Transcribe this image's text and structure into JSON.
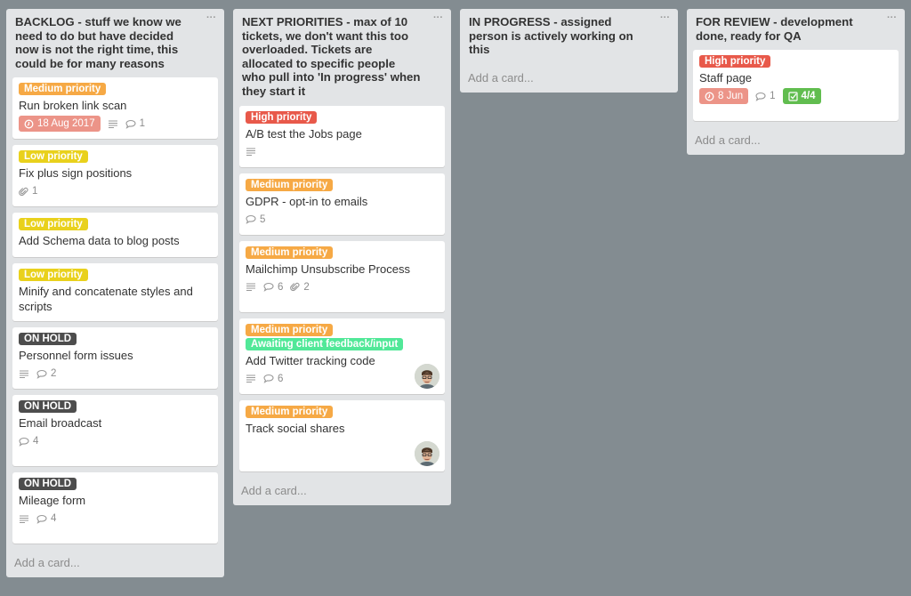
{
  "board": {
    "background": "#838c91",
    "lists": [
      {
        "title": "BACKLOG - stuff we know we need to do but have decided now is not the right time, this could be for many reasons",
        "menu_icon": "ellipsis-icon",
        "add_card": "Add a card...",
        "cards": [
          {
            "labels": [
              {
                "text": "Medium priority",
                "color": "#f6a945"
              }
            ],
            "title": "Run broken link scan",
            "badges": {
              "due": "18 Aug 2017",
              "description": true,
              "comments": "1"
            }
          },
          {
            "labels": [
              {
                "text": "Low priority",
                "color": "#e9d11c"
              }
            ],
            "title": "Fix plus sign positions",
            "badges": {
              "attachments": "1"
            }
          },
          {
            "labels": [
              {
                "text": "Low priority",
                "color": "#e9d11c"
              }
            ],
            "title": "Add Schema data to blog posts",
            "badges": {}
          },
          {
            "labels": [
              {
                "text": "Low priority",
                "color": "#e9d11c"
              }
            ],
            "title": "Minify and concatenate styles and scripts",
            "badges": {}
          },
          {
            "labels": [
              {
                "text": "ON HOLD",
                "color": "#4d4d4d"
              }
            ],
            "title": "Personnel form issues",
            "badges": {
              "description": true,
              "comments": "2"
            }
          },
          {
            "labels": [
              {
                "text": "ON HOLD",
                "color": "#4d4d4d"
              }
            ],
            "title": "Email broadcast",
            "badges": {
              "comments": "4"
            },
            "tall": true
          },
          {
            "labels": [
              {
                "text": "ON HOLD",
                "color": "#4d4d4d"
              }
            ],
            "title": "Mileage form",
            "badges": {
              "description": true,
              "comments": "4"
            },
            "tall": true
          }
        ]
      },
      {
        "title": "NEXT PRIORITIES - max of 10 tickets, we don't want this too overloaded. Tickets are allocated to specific people who pull into 'In progress' when they start it",
        "menu_icon": "ellipsis-icon",
        "add_card": "Add a card...",
        "cards": [
          {
            "labels": [
              {
                "text": "High priority",
                "color": "#e8594a"
              }
            ],
            "title": "A/B test the Jobs page",
            "badges": {
              "description": true
            }
          },
          {
            "labels": [
              {
                "text": "Medium priority",
                "color": "#f6a945"
              }
            ],
            "title": "GDPR - opt-in to emails",
            "badges": {
              "comments": "5"
            }
          },
          {
            "labels": [
              {
                "text": "Medium priority",
                "color": "#f6a945"
              }
            ],
            "title": "Mailchimp Unsubscribe Process",
            "badges": {
              "description": true,
              "comments": "6",
              "attachments": "2"
            },
            "tall": true
          },
          {
            "labels": [
              {
                "text": "Medium priority",
                "color": "#f6a945"
              },
              {
                "text": "Awaiting client feedback/input",
                "color": "#51e898"
              }
            ],
            "title": "Add Twitter tracking code",
            "badges": {
              "description": true,
              "comments": "6"
            },
            "avatar": "member-avatar"
          },
          {
            "labels": [
              {
                "text": "Medium priority",
                "color": "#f6a945"
              }
            ],
            "title": "Track social shares",
            "badges": {},
            "avatar": "member-avatar",
            "tall": true
          }
        ]
      },
      {
        "title": "IN PROGRESS - assigned person is actively working on this",
        "menu_icon": "ellipsis-icon",
        "add_card": "Add a card...",
        "cards": []
      },
      {
        "title": "FOR REVIEW - development done, ready for QA",
        "menu_icon": "ellipsis-icon",
        "add_card": "Add a card...",
        "cards": [
          {
            "labels": [
              {
                "text": "High priority",
                "color": "#e8594a"
              }
            ],
            "title": "Staff page",
            "badges": {
              "due": "8 Jun",
              "comments": "1",
              "checklist": "4/4"
            },
            "tall": true
          }
        ]
      }
    ]
  }
}
